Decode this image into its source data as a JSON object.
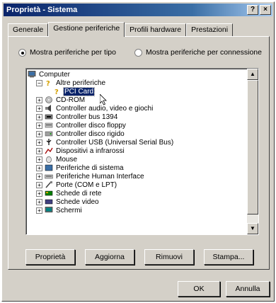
{
  "window": {
    "title": "Proprietà - Sistema",
    "help_button": "?",
    "close_button": "×"
  },
  "tabs": [
    {
      "label": "Generale"
    },
    {
      "label": "Gestione periferiche"
    },
    {
      "label": "Profili hardware"
    },
    {
      "label": "Prestazioni"
    }
  ],
  "view_options": {
    "by_type": "Mostra periferiche per tipo",
    "by_connection": "Mostra periferiche per connessione",
    "selected": "by_type"
  },
  "tree": {
    "items": [
      {
        "label": "Computer",
        "icon": "computer-icon",
        "expander": "",
        "selected": false
      },
      {
        "label": "Altre periferiche",
        "icon": "question-device-icon",
        "expander": "−",
        "selected": false
      },
      {
        "label": "PCI Card",
        "icon": "question-device-icon",
        "expander": "",
        "selected": true
      },
      {
        "label": "CD-ROM",
        "icon": "cdrom-icon",
        "expander": "+",
        "selected": false
      },
      {
        "label": "Controller audio, video e giochi",
        "icon": "sound-icon",
        "expander": "+",
        "selected": false
      },
      {
        "label": "Controller bus 1394",
        "icon": "bus-1394-icon",
        "expander": "+",
        "selected": false
      },
      {
        "label": "Controller disco floppy",
        "icon": "floppy-controller-icon",
        "expander": "+",
        "selected": false
      },
      {
        "label": "Controller disco rigido",
        "icon": "disk-controller-icon",
        "expander": "+",
        "selected": false
      },
      {
        "label": "Controller USB (Universal Serial Bus)",
        "icon": "usb-icon",
        "expander": "+",
        "selected": false
      },
      {
        "label": "Dispositivi a infrarossi",
        "icon": "infrared-icon",
        "expander": "+",
        "selected": false
      },
      {
        "label": "Mouse",
        "icon": "mouse-icon",
        "expander": "+",
        "selected": false
      },
      {
        "label": "Periferiche di sistema",
        "icon": "system-device-icon",
        "expander": "+",
        "selected": false
      },
      {
        "label": "Periferiche Human Interface",
        "icon": "hid-icon",
        "expander": "+",
        "selected": false
      },
      {
        "label": "Porte (COM e LPT)",
        "icon": "port-icon",
        "expander": "+",
        "selected": false
      },
      {
        "label": "Schede di rete",
        "icon": "network-card-icon",
        "expander": "+",
        "selected": false
      },
      {
        "label": "Schede video",
        "icon": "display-adapter-icon",
        "expander": "+",
        "selected": false
      },
      {
        "label": "Schermi",
        "icon": "monitor-icon",
        "expander": "+",
        "selected": false
      }
    ]
  },
  "buttons": {
    "properties": "Proprietà",
    "refresh": "Aggiorna",
    "remove": "Rimuovi",
    "print": "Stampa...",
    "ok": "OK",
    "cancel": "Annulla"
  },
  "colors": {
    "titlebar_start": "#0a246a",
    "titlebar_end": "#a6caf0",
    "selection": "#0a246a",
    "face": "#d4d0c8"
  }
}
